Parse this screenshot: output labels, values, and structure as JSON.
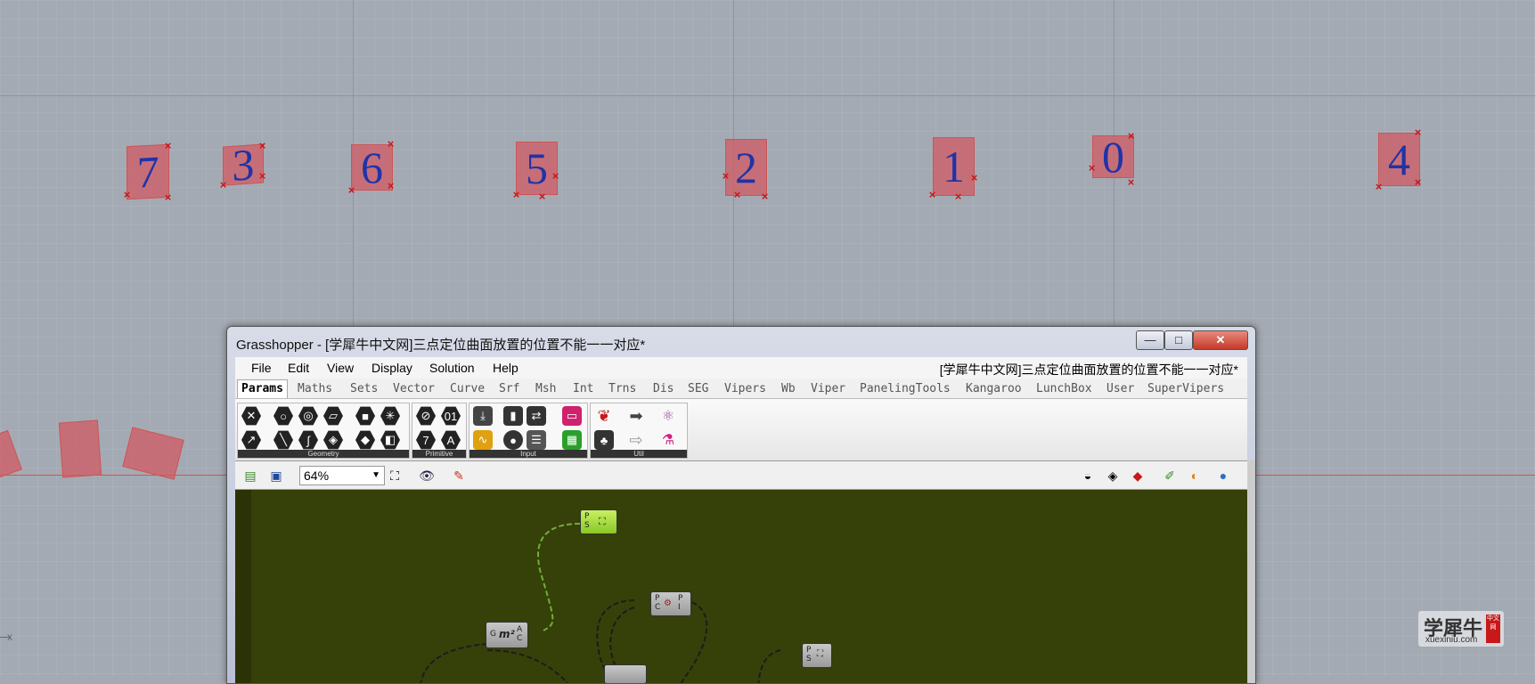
{
  "viewport": {
    "tiles": [
      "7",
      "3",
      "6",
      "5",
      "2",
      "1",
      "0",
      "4"
    ],
    "world_axis_label": "x"
  },
  "window": {
    "title": "Grasshopper - [学犀牛中文网]三点定位曲面放置的位置不能一一对应*",
    "buttons": {
      "minimize": "—",
      "maximize": "□",
      "close": "✕"
    },
    "menu": [
      "File",
      "Edit",
      "View",
      "Display",
      "Solution",
      "Help"
    ],
    "document_title": "[学犀牛中文网]三点定位曲面放置的位置不能一一对应*",
    "tabs": [
      "Params",
      "Maths",
      "Sets",
      "Vector",
      "Curve",
      "Srf",
      "Msh",
      "Int",
      "Trns",
      "Dis",
      "SEG",
      "Vipers",
      "Wb",
      "Viper",
      "PanelingTools",
      "Kangaroo",
      "LunchBox",
      "User",
      "SuperVipers"
    ],
    "ribbon_panels": [
      "Geometry",
      "Primitive",
      "Input",
      "Util"
    ],
    "zoom": "64%"
  },
  "nodes": {
    "green_node": {
      "in": "P\nS"
    },
    "node_ps_right": {
      "in": "P\nC",
      "out": "P\nI"
    },
    "area_node": {
      "in": "G",
      "glyph": "m²",
      "out": "A\nC"
    },
    "bottom_node": {
      "in": "P\nS"
    }
  },
  "watermark": {
    "cn": "学犀牛",
    "url": "xuexiniu.com",
    "badge": "中文网"
  }
}
